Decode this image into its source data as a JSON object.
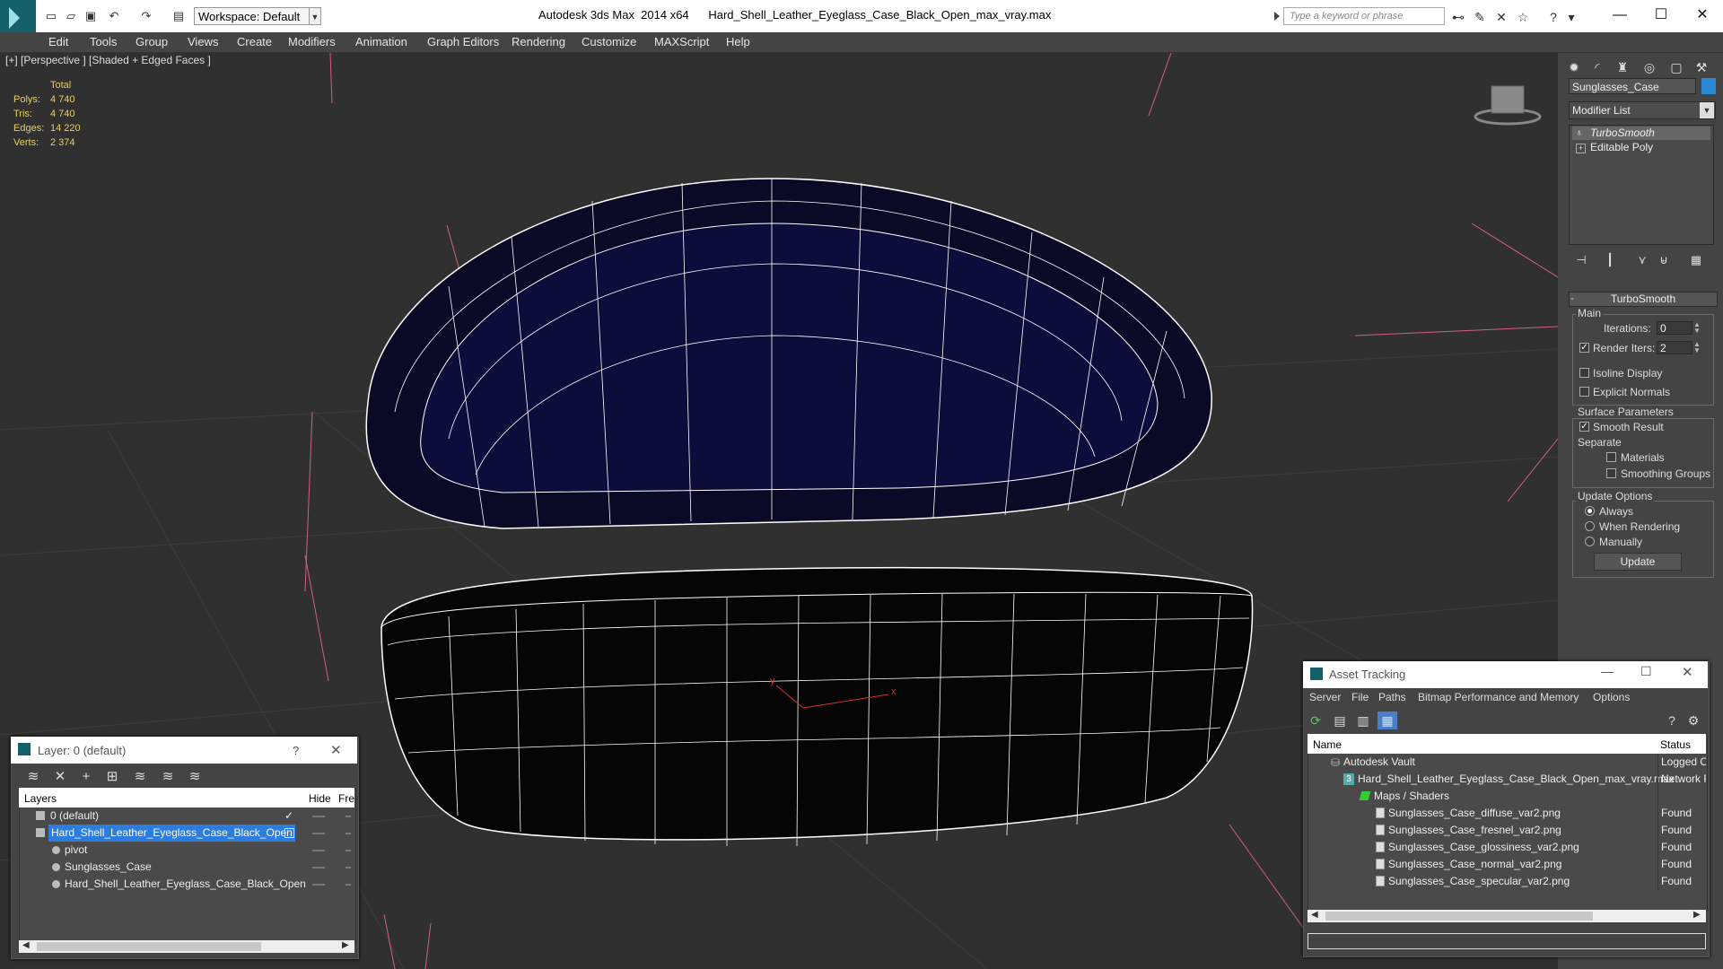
{
  "window": {
    "workspace_label": "Workspace: Default",
    "app_title": "Autodesk 3ds Max  2014 x64      Hard_Shell_Leather_Eyeglass_Case_Black_Open_max_vray.max",
    "search_placeholder": "Type a keyword or phrase"
  },
  "menu": [
    "Edit",
    "Tools",
    "Group",
    "Views",
    "Create",
    "Modifiers",
    "Animation",
    "Graph Editors",
    "Rendering",
    "Customize",
    "MAXScript",
    "Help"
  ],
  "viewport": {
    "label": "[+] [Perspective ] [Shaded + Edged Faces ]",
    "stats_header": "Total",
    "stats": [
      {
        "label": "Polys:",
        "value": "4 740"
      },
      {
        "label": "Tris:",
        "value": "4 740"
      },
      {
        "label": "Edges:",
        "value": "14 220"
      },
      {
        "label": "Verts:",
        "value": "2 374"
      }
    ]
  },
  "command_panel": {
    "object_name": "Sunglasses_Case",
    "object_color": "#2d86d4",
    "modifier_list": "Modifier List",
    "stack": [
      "TurboSmooth",
      "Editable Poly"
    ],
    "rollout_title": "TurboSmooth",
    "main_group": "Main",
    "iterations_label": "Iterations:",
    "iterations_value": "0",
    "render_iters_label": "Render Iters:",
    "render_iters_value": "2",
    "isoline_label": "Isoline Display",
    "explicit_normals_label": "Explicit Normals",
    "surface_group": "Surface Parameters",
    "smooth_result_label": "Smooth Result",
    "separate_label": "Separate",
    "materials_label": "Materials",
    "smoothing_groups_label": "Smoothing Groups",
    "update_group": "Update Options",
    "always_label": "Always",
    "when_rendering_label": "When Rendering",
    "manually_label": "Manually",
    "update_button": "Update"
  },
  "layer_dialog": {
    "title": "Layer: 0 (default)",
    "help": "?",
    "col_layers": "Layers",
    "col_hide": "Hide",
    "col_freeze": "Fre",
    "rows": [
      {
        "name": "0 (default)",
        "indent": 0
      },
      {
        "name": "Hard_Shell_Leather_Eyeglass_Case_Black_Open",
        "indent": 0
      },
      {
        "name": "pivot",
        "indent": 1
      },
      {
        "name": "Sunglasses_Case",
        "indent": 1
      },
      {
        "name": "Hard_Shell_Leather_Eyeglass_Case_Black_Open",
        "indent": 1
      }
    ]
  },
  "asset_dialog": {
    "title": "Asset Tracking",
    "menu": [
      "Server",
      "File",
      "Paths",
      "Bitmap Performance and Memory",
      "Options"
    ],
    "col_name": "Name",
    "col_status": "Status",
    "rows": [
      {
        "name": "Autodesk Vault",
        "indent": 0,
        "status": "Logged O"
      },
      {
        "name": "Hard_Shell_Leather_Eyeglass_Case_Black_Open_max_vray.max",
        "indent": 1,
        "status": "Network F"
      },
      {
        "name": "Maps / Shaders",
        "indent": 2,
        "status": ""
      },
      {
        "name": "Sunglasses_Case_diffuse_var2.png",
        "indent": 3,
        "status": "Found"
      },
      {
        "name": "Sunglasses_Case_fresnel_var2.png",
        "indent": 3,
        "status": "Found"
      },
      {
        "name": "Sunglasses_Case_glossiness_var2.png",
        "indent": 3,
        "status": "Found"
      },
      {
        "name": "Sunglasses_Case_normal_var2.png",
        "indent": 3,
        "status": "Found"
      },
      {
        "name": "Sunglasses_Case_specular_var2.png",
        "indent": 3,
        "status": "Found"
      }
    ]
  }
}
